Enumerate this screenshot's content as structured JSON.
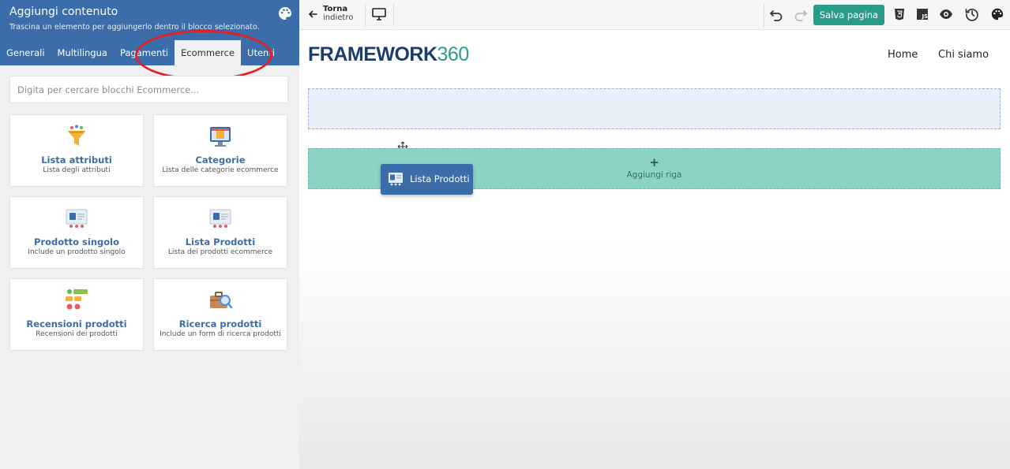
{
  "panel": {
    "title": "Aggiungi contenuto",
    "subtitle": "Trascina un elemento per aggiungerlo dentro il blocco selezionato.",
    "tabs": [
      "Generali",
      "Multilingua",
      "Pagamenti",
      "Ecommerce",
      "Utenti"
    ],
    "active_tab": "Ecommerce",
    "search_placeholder": "Digita per cercare blocchi Ecommerce...",
    "cards": [
      {
        "title": "Lista attributi",
        "desc": "Lista degli attributi",
        "icon": "funnel-icon"
      },
      {
        "title": "Categorie",
        "desc": "Lista delle categorie ecommerce",
        "icon": "monitor-category-icon"
      },
      {
        "title": "Prodotto singolo",
        "desc": "Include un prodotto singolo",
        "icon": "shop-product-icon"
      },
      {
        "title": "Lista Prodotti",
        "desc": "Lista dei prodotti ecommerce",
        "icon": "shop-product-list-icon"
      },
      {
        "title": "Recensioni prodotti",
        "desc": "Recensioni dei prodotti",
        "icon": "reviews-grid-icon"
      },
      {
        "title": "Ricerca prodotti",
        "desc": "Include un form di ricerca prodotti",
        "icon": "search-briefcase-icon"
      }
    ]
  },
  "toolbar": {
    "back_line1": "Torna",
    "back_line2": "indietro",
    "save_label": "Salva pagina",
    "icons": [
      "undo-icon",
      "redo-icon",
      "html5-icon",
      "js-icon",
      "eye-icon",
      "history-icon",
      "palette-icon"
    ]
  },
  "site": {
    "logo_text": "FRAMEWORK",
    "logo_number": "360",
    "nav": [
      "Home",
      "Chi siamo"
    ],
    "add_row_plus": "+",
    "add_row_label": "Aggiungi riga",
    "drag_label": "Lista Prodotti"
  },
  "colors": {
    "header_blue": "#3a6da9",
    "accent_teal": "#2a9d8a",
    "add_row_bg": "#8bd3c6",
    "highlight_red": "#e31e24"
  }
}
